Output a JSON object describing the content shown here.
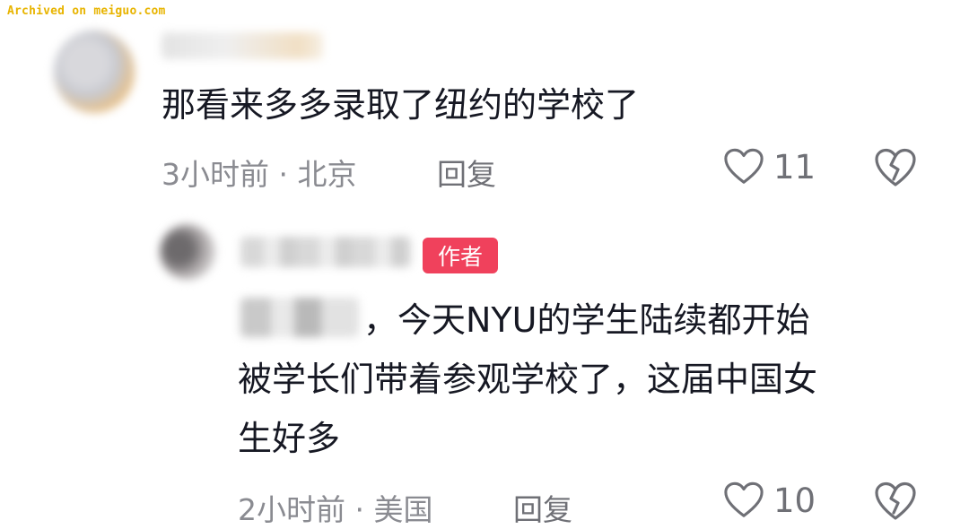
{
  "watermark": "Archived on meiguo.com",
  "comments": [
    {
      "text": "那看来多多录取了纽约的学校了",
      "time": "3小时前",
      "location": "北京",
      "reply_label": "回复",
      "likes": "11"
    },
    {
      "badge": "作者",
      "text_line1": "，今天NYU的学生陆续都开始",
      "text_line2": "被学长们带着参观学校了，这届中国女",
      "text_line3": "生好多",
      "time": "2小时前",
      "location": "美国",
      "reply_label": "回复",
      "likes": "10"
    }
  ],
  "colors": {
    "badge": "#f0415c",
    "meta": "#8a8b91",
    "text": "#161823",
    "watermark": "#e8b400"
  },
  "icons": [
    "heart-outline-icon",
    "broken-heart-icon"
  ]
}
